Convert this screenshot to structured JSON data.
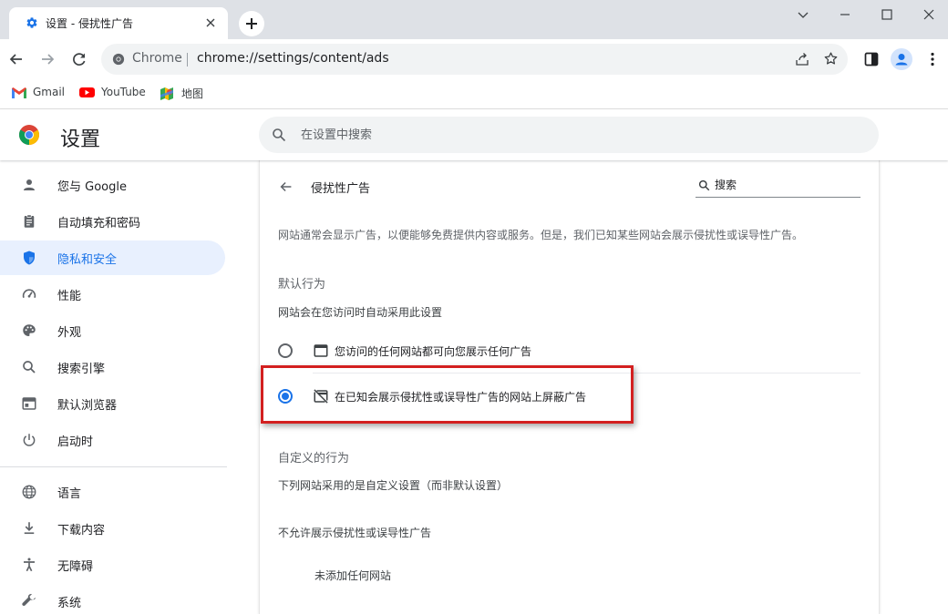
{
  "tab": {
    "title": "设置 - 侵扰性广告"
  },
  "toolbar": {
    "omnibox_site_label": "Chrome",
    "omnibox_url": "chrome://settings/content/ads"
  },
  "bookmarks": [
    {
      "label": "Gmail",
      "icon": "gmail-icon"
    },
    {
      "label": "YouTube",
      "icon": "youtube-icon"
    },
    {
      "label": "地图",
      "icon": "maps-icon"
    }
  ],
  "header": {
    "title": "设置",
    "search_placeholder": "在设置中搜索"
  },
  "sidebar": {
    "items": [
      {
        "label": "您与 Google",
        "icon": "person-icon"
      },
      {
        "label": "自动填充和密码",
        "icon": "clipboard-icon"
      },
      {
        "label": "隐私和安全",
        "icon": "shield-icon",
        "active": true
      },
      {
        "label": "性能",
        "icon": "speedometer-icon"
      },
      {
        "label": "外观",
        "icon": "palette-icon"
      },
      {
        "label": "搜索引擎",
        "icon": "search-icon"
      },
      {
        "label": "默认浏览器",
        "icon": "browser-icon"
      },
      {
        "label": "启动时",
        "icon": "power-icon"
      },
      {
        "label": "语言",
        "icon": "globe-icon"
      },
      {
        "label": "下载内容",
        "icon": "download-icon"
      },
      {
        "label": "无障碍",
        "icon": "accessibility-icon"
      },
      {
        "label": "系统",
        "icon": "wrench-icon"
      }
    ]
  },
  "main": {
    "heading": "侵扰性广告",
    "search_placeholder": "搜索",
    "description": "网站通常会显示广告，以便能够免费提供内容或服务。但是，我们已知某些网站会展示侵扰性或误导性广告。",
    "default_behavior": {
      "title": "默认行为",
      "subtitle": "网站会在您访问时自动采用此设置",
      "options": [
        {
          "label": "您访问的任何网站都可向您展示任何广告",
          "icon": "ad-icon",
          "selected": false
        },
        {
          "label": "在已知会展示侵扰性或误导性广告的网站上屏蔽广告",
          "icon": "ad-blocked-icon",
          "selected": true
        }
      ]
    },
    "custom_behavior": {
      "title": "自定义的行为",
      "subtitle": "下列网站采用的是自定义设置（而非默认设置）",
      "block_list_title": "不允许展示侵扰性或误导性广告",
      "empty_message": "未添加任何网站"
    }
  },
  "colors": {
    "accent": "#1a73e8",
    "active_nav_bg": "#e8f0fe",
    "highlight_border": "#d32020",
    "tabstrip_bg": "#dee1e6"
  }
}
